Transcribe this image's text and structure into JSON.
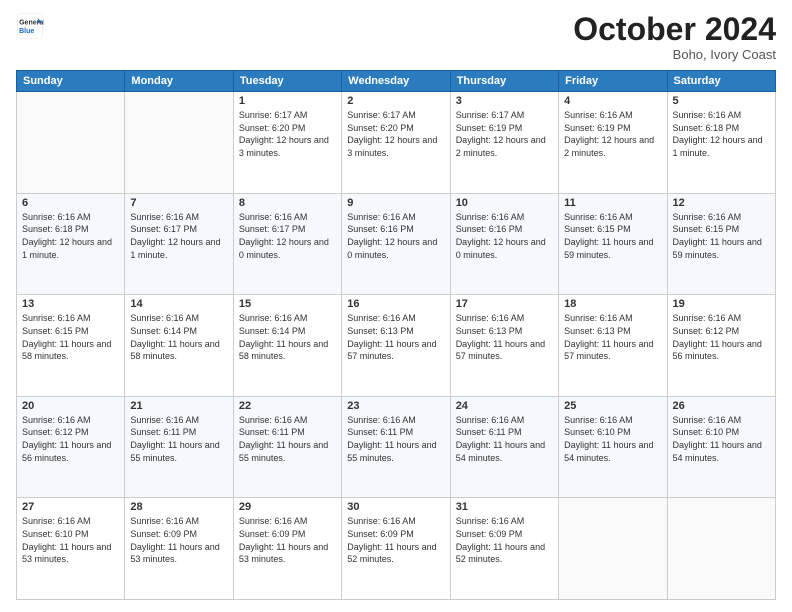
{
  "header": {
    "logo_line1": "General",
    "logo_line2": "Blue",
    "month": "October 2024",
    "location": "Boho, Ivory Coast"
  },
  "weekdays": [
    "Sunday",
    "Monday",
    "Tuesday",
    "Wednesday",
    "Thursday",
    "Friday",
    "Saturday"
  ],
  "weeks": [
    [
      {
        "day": "",
        "info": ""
      },
      {
        "day": "",
        "info": ""
      },
      {
        "day": "1",
        "info": "Sunrise: 6:17 AM\nSunset: 6:20 PM\nDaylight: 12 hours and 3 minutes."
      },
      {
        "day": "2",
        "info": "Sunrise: 6:17 AM\nSunset: 6:20 PM\nDaylight: 12 hours and 3 minutes."
      },
      {
        "day": "3",
        "info": "Sunrise: 6:17 AM\nSunset: 6:19 PM\nDaylight: 12 hours and 2 minutes."
      },
      {
        "day": "4",
        "info": "Sunrise: 6:16 AM\nSunset: 6:19 PM\nDaylight: 12 hours and 2 minutes."
      },
      {
        "day": "5",
        "info": "Sunrise: 6:16 AM\nSunset: 6:18 PM\nDaylight: 12 hours and 1 minute."
      }
    ],
    [
      {
        "day": "6",
        "info": "Sunrise: 6:16 AM\nSunset: 6:18 PM\nDaylight: 12 hours and 1 minute."
      },
      {
        "day": "7",
        "info": "Sunrise: 6:16 AM\nSunset: 6:17 PM\nDaylight: 12 hours and 1 minute."
      },
      {
        "day": "8",
        "info": "Sunrise: 6:16 AM\nSunset: 6:17 PM\nDaylight: 12 hours and 0 minutes."
      },
      {
        "day": "9",
        "info": "Sunrise: 6:16 AM\nSunset: 6:16 PM\nDaylight: 12 hours and 0 minutes."
      },
      {
        "day": "10",
        "info": "Sunrise: 6:16 AM\nSunset: 6:16 PM\nDaylight: 12 hours and 0 minutes."
      },
      {
        "day": "11",
        "info": "Sunrise: 6:16 AM\nSunset: 6:15 PM\nDaylight: 11 hours and 59 minutes."
      },
      {
        "day": "12",
        "info": "Sunrise: 6:16 AM\nSunset: 6:15 PM\nDaylight: 11 hours and 59 minutes."
      }
    ],
    [
      {
        "day": "13",
        "info": "Sunrise: 6:16 AM\nSunset: 6:15 PM\nDaylight: 11 hours and 58 minutes."
      },
      {
        "day": "14",
        "info": "Sunrise: 6:16 AM\nSunset: 6:14 PM\nDaylight: 11 hours and 58 minutes."
      },
      {
        "day": "15",
        "info": "Sunrise: 6:16 AM\nSunset: 6:14 PM\nDaylight: 11 hours and 58 minutes."
      },
      {
        "day": "16",
        "info": "Sunrise: 6:16 AM\nSunset: 6:13 PM\nDaylight: 11 hours and 57 minutes."
      },
      {
        "day": "17",
        "info": "Sunrise: 6:16 AM\nSunset: 6:13 PM\nDaylight: 11 hours and 57 minutes."
      },
      {
        "day": "18",
        "info": "Sunrise: 6:16 AM\nSunset: 6:13 PM\nDaylight: 11 hours and 57 minutes."
      },
      {
        "day": "19",
        "info": "Sunrise: 6:16 AM\nSunset: 6:12 PM\nDaylight: 11 hours and 56 minutes."
      }
    ],
    [
      {
        "day": "20",
        "info": "Sunrise: 6:16 AM\nSunset: 6:12 PM\nDaylight: 11 hours and 56 minutes."
      },
      {
        "day": "21",
        "info": "Sunrise: 6:16 AM\nSunset: 6:11 PM\nDaylight: 11 hours and 55 minutes."
      },
      {
        "day": "22",
        "info": "Sunrise: 6:16 AM\nSunset: 6:11 PM\nDaylight: 11 hours and 55 minutes."
      },
      {
        "day": "23",
        "info": "Sunrise: 6:16 AM\nSunset: 6:11 PM\nDaylight: 11 hours and 55 minutes."
      },
      {
        "day": "24",
        "info": "Sunrise: 6:16 AM\nSunset: 6:11 PM\nDaylight: 11 hours and 54 minutes."
      },
      {
        "day": "25",
        "info": "Sunrise: 6:16 AM\nSunset: 6:10 PM\nDaylight: 11 hours and 54 minutes."
      },
      {
        "day": "26",
        "info": "Sunrise: 6:16 AM\nSunset: 6:10 PM\nDaylight: 11 hours and 54 minutes."
      }
    ],
    [
      {
        "day": "27",
        "info": "Sunrise: 6:16 AM\nSunset: 6:10 PM\nDaylight: 11 hours and 53 minutes."
      },
      {
        "day": "28",
        "info": "Sunrise: 6:16 AM\nSunset: 6:09 PM\nDaylight: 11 hours and 53 minutes."
      },
      {
        "day": "29",
        "info": "Sunrise: 6:16 AM\nSunset: 6:09 PM\nDaylight: 11 hours and 53 minutes."
      },
      {
        "day": "30",
        "info": "Sunrise: 6:16 AM\nSunset: 6:09 PM\nDaylight: 11 hours and 52 minutes."
      },
      {
        "day": "31",
        "info": "Sunrise: 6:16 AM\nSunset: 6:09 PM\nDaylight: 11 hours and 52 minutes."
      },
      {
        "day": "",
        "info": ""
      },
      {
        "day": "",
        "info": ""
      }
    ]
  ]
}
